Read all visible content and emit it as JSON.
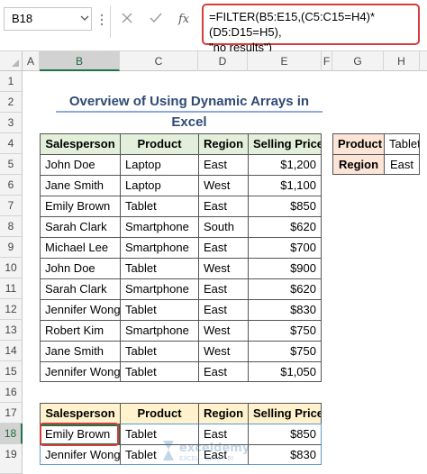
{
  "formula_bar": {
    "name_box": "B18",
    "formula_line1": "=FILTER(B5:E15,(C5:C15=H4)*(D5:D15=H5),",
    "formula_line2": "\"no results\")"
  },
  "columns": [
    "A",
    "B",
    "C",
    "D",
    "E",
    "F",
    "G",
    "H"
  ],
  "rows": [
    "1",
    "2",
    "3",
    "4",
    "5",
    "6",
    "7",
    "8",
    "9",
    "10",
    "11",
    "12",
    "13",
    "14",
    "15",
    "16",
    "17",
    "18",
    "19"
  ],
  "title": "Overview of Using Dynamic Arrays in Excel",
  "table": {
    "headers": [
      "Salesperson",
      "Product",
      "Region",
      "Selling Price"
    ],
    "rows": [
      [
        "John Doe",
        "Laptop",
        "East",
        "$1,200"
      ],
      [
        "Jane Smith",
        "Laptop",
        "West",
        "$1,100"
      ],
      [
        "Emily Brown",
        "Tablet",
        "East",
        "$850"
      ],
      [
        "Sarah Clark",
        "Smartphone",
        "South",
        "$620"
      ],
      [
        "Michael Lee",
        "Smartphone",
        "East",
        "$700"
      ],
      [
        "John Doe",
        "Tablet",
        "West",
        "$900"
      ],
      [
        "Sarah Clark",
        "Smartphone",
        "East",
        "$620"
      ],
      [
        "Jennifer Wong",
        "Tablet",
        "East",
        "$830"
      ],
      [
        "Robert Kim",
        "Smartphone",
        "West",
        "$750"
      ],
      [
        "Jane Smith",
        "Tablet",
        "West",
        "$750"
      ],
      [
        "Jennifer Wong",
        "Tablet",
        "East",
        "$1,050"
      ]
    ]
  },
  "criteria": {
    "product_label": "Product",
    "product_value": "Tablet",
    "region_label": "Region",
    "region_value": "East"
  },
  "result": {
    "headers": [
      "Salesperson",
      "Product",
      "Region",
      "Selling Price"
    ],
    "rows": [
      [
        "Emily Brown",
        "Tablet",
        "East",
        "$850"
      ],
      [
        "Jennifer Wong",
        "Tablet",
        "East",
        "$830"
      ]
    ]
  },
  "watermark": {
    "name": "exceldemy",
    "tagline": "EXCEL · DATA · BI"
  },
  "colors": {
    "header_green": "#e2efda",
    "header_yellow": "#fff2cc",
    "header_peach": "#fce4d6",
    "highlight_red": "#d93b3b",
    "excel_green": "#217346"
  }
}
